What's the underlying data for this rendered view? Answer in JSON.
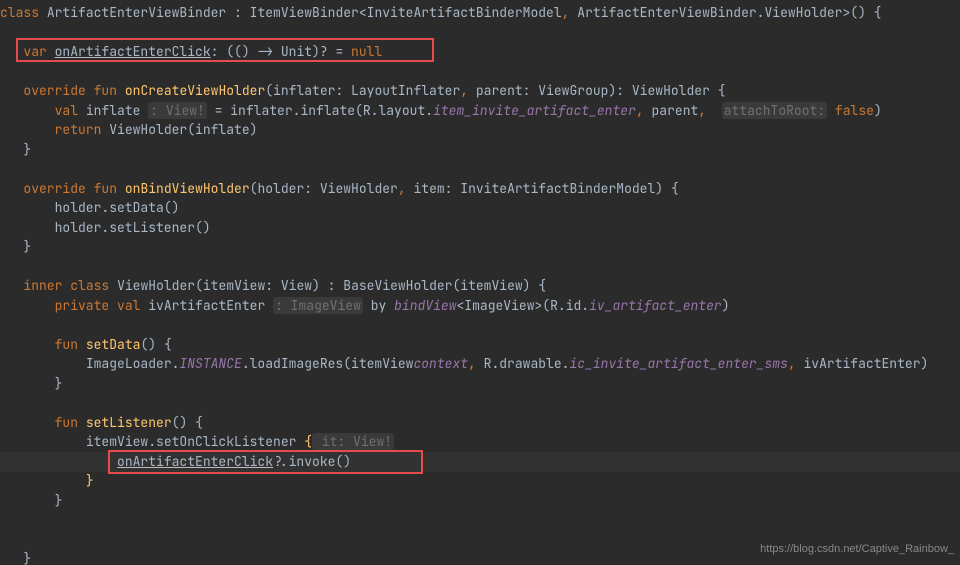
{
  "watermark": "https://blog.csdn.net/Captive_Rainbow_",
  "code": {
    "l01": {
      "kw_class": "class",
      "name": "ArtifactEnterViewBinder",
      "pu": " : ",
      "base": "ItemViewBinder<InviteArtifactBinderModel",
      "comma": ",",
      "rest": " ArtifactEnterViewBinder.ViewHolder>() {"
    },
    "l03": {
      "kw_var": "var",
      "name": "onArtifactEnterClick",
      "sig": ": (() -> Unit)? = ",
      "null": "null"
    },
    "l05": {
      "kw_over": "override",
      "kw_fun": "fun",
      "name": "onCreateViewHolder",
      "sig1": "(inflater: LayoutInflater",
      "c1": ",",
      "sig2": " parent: ViewGroup): ViewHolder {"
    },
    "l06": {
      "kw_val": "val",
      "var": "inflate",
      "hint": ": View!",
      "eq": " = inflater.inflate(R.layout.",
      "layout": "item_invite_artifact_enter",
      "c1": ",",
      "parent": " parent",
      "c2": ", ",
      "hint2": "attachToRoot:",
      "false": " false",
      ")": ")"
    },
    "l07": {
      "kw_return": "return",
      "rest": " ViewHolder(inflate)"
    },
    "l08": {
      "brace": "}"
    },
    "l10": {
      "kw_over": "override",
      "kw_fun": "fun",
      "name": "onBindViewHolder",
      "sig1": "(holder: ViewHolder",
      "c1": ",",
      "sig2": " item: I",
      "model": "nviteArtifactBinderModel",
      ") {": ") {"
    },
    "l11": {
      "txt": "holder.setData()"
    },
    "l12": {
      "txt": "holder.setListener()"
    },
    "l13": {
      "brace": "}"
    },
    "l15": {
      "kw_inner": "inner",
      "kw_class": "class",
      "name": "ViewHolder",
      "sig": "(itemView: View) : BaseViewHolder(itemView) {"
    },
    "l16": {
      "kw_priv": "private",
      "kw_val": "val",
      "var": "ivArtifactEnter",
      "hint": ": ImageView",
      "by": " by ",
      "bind": "bindView",
      "sig": "<ImageView>(R.id.",
      "id": "iv_artifact_enter",
      ")": ")"
    },
    "l18": {
      "kw_fun": "fun",
      "name": "setData",
      "sig": "() {"
    },
    "l19": {
      "txt1": "ImageLoader.",
      "inst": "INSTANCE",
      "txt2": ".loadImageRes(",
      "itv": "itemView",
      ".": ".",
      "ctx": "context",
      "c": ",",
      "txt3": " R.drawable.",
      "draw": "ic_invite_artifact_enter_sms",
      "c2": ",",
      "rest": " ivArtifactEnter)"
    },
    "l20": {
      "brace": "}"
    },
    "l22": {
      "kw_fun": "fun",
      "name": "setListener",
      "sig": "() {"
    },
    "l23": {
      "itv": "itemView",
      "txt": ".setOnClickListener ",
      "lb": "{",
      "it": " it: View!"
    },
    "l24": {
      "name": "onArtifactEnterClick",
      "txt": "?.invoke()"
    },
    "l25": {
      "lb": "}"
    },
    "l26": {
      "brace": "}"
    },
    "l29": {
      "brace": "}"
    }
  }
}
